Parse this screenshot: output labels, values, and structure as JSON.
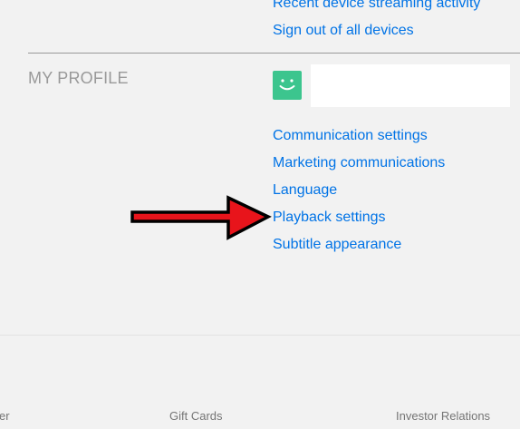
{
  "account_links": {
    "recent_streaming": "Recent device streaming activity",
    "sign_out_all": "Sign out of all devices"
  },
  "profile_section": {
    "title": "MY PROFILE",
    "avatar_color": "#3cc58e",
    "links": [
      "Communication settings",
      "Marketing communications",
      "Language",
      "Playback settings",
      "Subtitle appearance"
    ]
  },
  "annotation": {
    "arrow_color": "#e8141b",
    "pointing_to": "Playback settings"
  },
  "footer": {
    "links": [
      "er",
      "Gift Cards",
      "Investor Relations"
    ]
  },
  "colors": {
    "link": "#0073e6",
    "background": "#f2f2f2"
  }
}
